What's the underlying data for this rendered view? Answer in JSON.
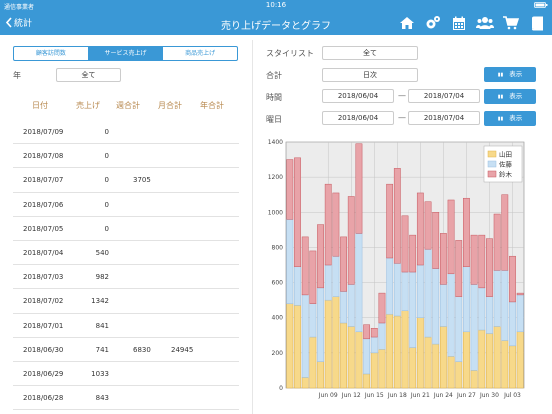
{
  "status_bar": {
    "carrier": "通信事業者",
    "time": "10:16"
  },
  "nav": {
    "back_label": "統計",
    "title": "売り上げデータとグラフ",
    "icons": [
      "home-icon",
      "settings-icon",
      "calendar-icon",
      "users-icon",
      "cart-icon",
      "book-icon"
    ]
  },
  "tabs": {
    "items": [
      "顧客訪問数",
      "サービス売上げ",
      "商品売上げ"
    ],
    "active": 1
  },
  "filters": {
    "year_label": "年",
    "year_value": "全て",
    "stylist_label": "スタイリスト",
    "stylist_value": "全て",
    "total_label": "合計",
    "total_value": "日次",
    "time_label": "時間",
    "time_from": "2018/06/04",
    "time_to": "2018/07/04",
    "weekday_label": "曜日",
    "weekday_from": "2018/06/04",
    "weekday_to": "2018/07/04",
    "range_separator": "—",
    "show_button": "表示"
  },
  "table": {
    "headers": {
      "date": "日付",
      "sales": "売上げ",
      "week": "週合計",
      "month": "月合計",
      "year": "年合計"
    },
    "rows": [
      {
        "date": "2018/07/09",
        "sales": "0",
        "week": "",
        "month": ""
      },
      {
        "date": "2018/07/08",
        "sales": "0",
        "week": "",
        "month": ""
      },
      {
        "date": "2018/07/07",
        "sales": "0",
        "week": "3705",
        "month": ""
      },
      {
        "date": "2018/07/06",
        "sales": "0",
        "week": "",
        "month": ""
      },
      {
        "date": "2018/07/05",
        "sales": "0",
        "week": "",
        "month": ""
      },
      {
        "date": "2018/07/04",
        "sales": "540",
        "week": "",
        "month": ""
      },
      {
        "date": "2018/07/03",
        "sales": "982",
        "week": "",
        "month": ""
      },
      {
        "date": "2018/07/02",
        "sales": "1342",
        "week": "",
        "month": ""
      },
      {
        "date": "2018/07/01",
        "sales": "841",
        "week": "",
        "month": ""
      },
      {
        "date": "2018/06/30",
        "sales": "741",
        "week": "6830",
        "month": "24945"
      },
      {
        "date": "2018/06/29",
        "sales": "1033",
        "week": "",
        "month": ""
      },
      {
        "date": "2018/06/28",
        "sales": "843",
        "week": "",
        "month": ""
      }
    ]
  },
  "colors": {
    "accent": "#3a98d6",
    "yamada": "#f7d98a",
    "sato": "#c6dff3",
    "suzuki": "#e8a3a8"
  },
  "chart_data": {
    "type": "bar",
    "stacked": true,
    "ylim": [
      0,
      1400
    ],
    "yticks": [
      "0",
      "200",
      "400",
      "600",
      "800",
      "1000",
      "1200",
      "1400"
    ],
    "xticks": [
      {
        "label": "Jun 09",
        "index": 5
      },
      {
        "label": "Jun 12",
        "index": 8
      },
      {
        "label": "Jun 15",
        "index": 11
      },
      {
        "label": "Jun 18",
        "index": 14
      },
      {
        "label": "Jun 21",
        "index": 17
      },
      {
        "label": "Jun 24",
        "index": 20
      },
      {
        "label": "Jun 27",
        "index": 23
      },
      {
        "label": "Jun 30",
        "index": 26
      },
      {
        "label": "Jul 03",
        "index": 29
      }
    ],
    "legend_position": "top-right",
    "grid": true,
    "categories": [
      "Jun 04",
      "Jun 05",
      "Jun 06",
      "Jun 07",
      "Jun 08",
      "Jun 09",
      "Jun 10",
      "Jun 11",
      "Jun 12",
      "Jun 13",
      "Jun 14",
      "Jun 15",
      "Jun 16",
      "Jun 17",
      "Jun 18",
      "Jun 19",
      "Jun 20",
      "Jun 21",
      "Jun 22",
      "Jun 23",
      "Jun 24",
      "Jun 25",
      "Jun 26",
      "Jun 27",
      "Jun 28",
      "Jun 29",
      "Jun 30",
      "Jul 01",
      "Jul 02",
      "Jul 03",
      "Jul 04"
    ],
    "series": [
      {
        "name": "山田",
        "color": "#f7d98a",
        "values": [
          480,
          470,
          60,
          290,
          150,
          500,
          520,
          370,
          350,
          320,
          80,
          200,
          220,
          420,
          410,
          440,
          230,
          400,
          290,
          250,
          350,
          180,
          150,
          320,
          100,
          330,
          310,
          350,
          270,
          240,
          320
        ]
      },
      {
        "name": "佐藤",
        "color": "#c6dff3",
        "values": [
          480,
          220,
          470,
          190,
          420,
          200,
          230,
          180,
          240,
          560,
          200,
          90,
          150,
          320,
          300,
          220,
          430,
          300,
          500,
          430,
          240,
          470,
          370,
          370,
          490,
          240,
          210,
          320,
          400,
          250,
          210
        ]
      },
      {
        "name": "鈴木",
        "color": "#e8a3a8",
        "values": [
          340,
          620,
          330,
          300,
          360,
          460,
          360,
          310,
          500,
          510,
          80,
          50,
          170,
          420,
          540,
          320,
          210,
          410,
          270,
          320,
          290,
          420,
          320,
          390,
          280,
          300,
          330,
          320,
          430,
          260,
          10
        ]
      }
    ]
  }
}
